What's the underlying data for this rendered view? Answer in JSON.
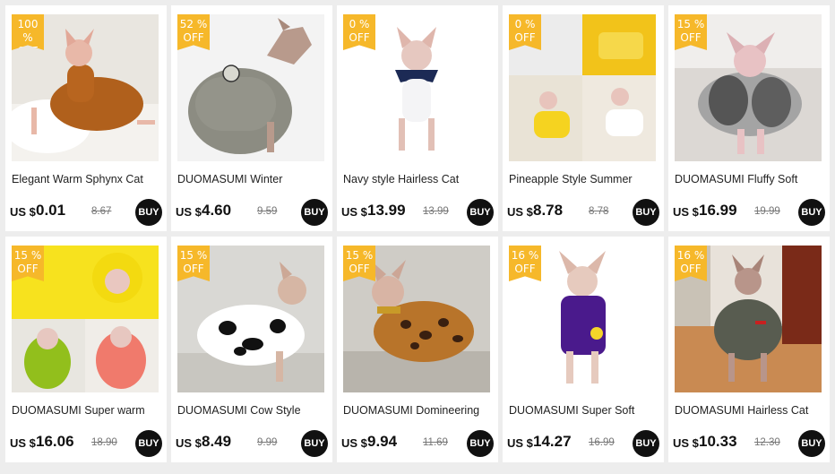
{
  "products": [
    {
      "discount_num": "100 %",
      "discount_label": "OFF",
      "title": "Elegant  Warm  Sphynx Cat",
      "currency": "US $",
      "price": "0.01",
      "old_price": "8.67",
      "buy_label": "BUY",
      "image_icon": "cat-brown-sweater-image"
    },
    {
      "discount_num": "52 %",
      "discount_label": "OFF",
      "title": "DUOMASUMI Winter",
      "currency": "US $",
      "price": "4.60",
      "old_price": "9.59",
      "buy_label": "BUY",
      "image_icon": "cat-grey-fleece-image"
    },
    {
      "discount_num": "0 %",
      "discount_label": "OFF",
      "title": "Navy style Hairless Cat",
      "currency": "US $",
      "price": "13.99",
      "old_price": "13.99",
      "buy_label": "BUY",
      "image_icon": "cat-navy-style-image"
    },
    {
      "discount_num": "0 %",
      "discount_label": "OFF",
      "title": "Pineapple Style Summer",
      "currency": "US $",
      "price": "8.78",
      "old_price": "8.78",
      "buy_label": "BUY",
      "image_icon": "cat-pineapple-style-image"
    },
    {
      "discount_num": "15 %",
      "discount_label": "OFF",
      "title": "DUOMASUMI Fluffy Soft",
      "currency": "US $",
      "price": "16.99",
      "old_price": "19.99",
      "buy_label": "BUY",
      "image_icon": "cat-fluffy-sweater-image"
    },
    {
      "discount_num": "15 %",
      "discount_label": "OFF",
      "title": "DUOMASUMI Super warm",
      "currency": "US $",
      "price": "16.06",
      "old_price": "18.90",
      "buy_label": "BUY",
      "image_icon": "cat-chick-costume-image"
    },
    {
      "discount_num": "15 %",
      "discount_label": "OFF",
      "title": "DUOMASUMI Cow Style",
      "currency": "US $",
      "price": "8.49",
      "old_price": "9.99",
      "buy_label": "BUY",
      "image_icon": "cat-cow-print-image"
    },
    {
      "discount_num": "15 %",
      "discount_label": "OFF",
      "title": "DUOMASUMI Domineering",
      "currency": "US $",
      "price": "9.94",
      "old_price": "11.69",
      "buy_label": "BUY",
      "image_icon": "cat-leopard-print-image"
    },
    {
      "discount_num": "16 %",
      "discount_label": "OFF",
      "title": "DUOMASUMI Super Soft",
      "currency": "US $",
      "price": "14.27",
      "old_price": "16.99",
      "buy_label": "BUY",
      "image_icon": "cat-purple-sweater-image"
    },
    {
      "discount_num": "16 %",
      "discount_label": "OFF",
      "title": "DUOMASUMI Hairless Cat",
      "currency": "US $",
      "price": "10.33",
      "old_price": "12.30",
      "buy_label": "BUY",
      "image_icon": "cat-grey-hoodie-image"
    }
  ],
  "colors": {
    "discount_badge": "#f6b82a",
    "buy_button": "#111111",
    "page_bg": "#ededed",
    "card_bg": "#ffffff"
  }
}
